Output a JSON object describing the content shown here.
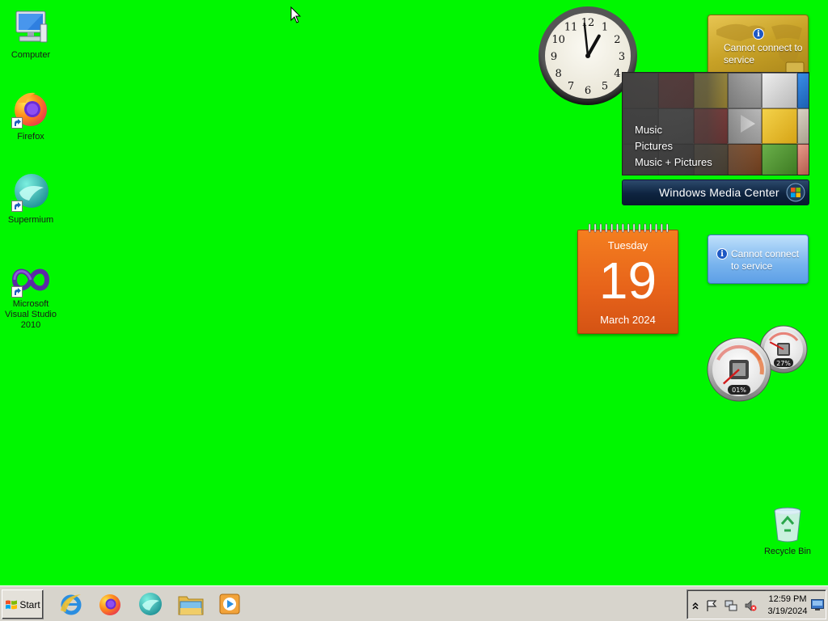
{
  "desktop": {
    "icons": [
      {
        "label": "Computer",
        "icon": "computer-icon"
      },
      {
        "label": "Firefox",
        "icon": "firefox-icon"
      },
      {
        "label": "Supermium",
        "icon": "supermium-icon"
      },
      {
        "label": "Microsoft Visual Studio 2010",
        "icon": "visual-studio-icon"
      },
      {
        "label": "Recycle Bin",
        "icon": "recycle-bin-icon"
      }
    ]
  },
  "gadgets": {
    "clock": {
      "hour_numerals": [
        "12",
        "1",
        "2",
        "3",
        "4",
        "5",
        "6",
        "7",
        "8",
        "9",
        "10",
        "11"
      ],
      "time": "12:59"
    },
    "currency": {
      "message": "Cannot connect to service",
      "icon": "info-icon"
    },
    "weather": {
      "message": "Cannot connect to service",
      "icon": "info-icon"
    },
    "media_center": {
      "menu": [
        "Music",
        "Pictures",
        "Music + Pictures"
      ],
      "brand": "Windows Media Center"
    },
    "calendar": {
      "weekday": "Tuesday",
      "day": "19",
      "month_year": "March 2024"
    },
    "cpu_meter": {
      "cpu_usage": "01%",
      "memory_usage": "27%",
      "cpu_fraction": 0.01,
      "memory_fraction": 0.27
    }
  },
  "taskbar": {
    "start_label": "Start",
    "pinned": [
      "internet-explorer-icon",
      "firefox-icon",
      "supermium-icon",
      "windows-explorer-icon",
      "media-player-icon"
    ],
    "tray": {
      "icons": [
        "show-hidden-icons-chevron-icon",
        "action-center-flag-icon",
        "network-icon",
        "volume-muted-icon"
      ],
      "time": "12:59 PM",
      "date": "3/19/2024"
    }
  },
  "colors": {
    "desktop_background": "#00f700",
    "calendar_orange": "#e6621a",
    "taskbar": "#d7d4cc"
  }
}
